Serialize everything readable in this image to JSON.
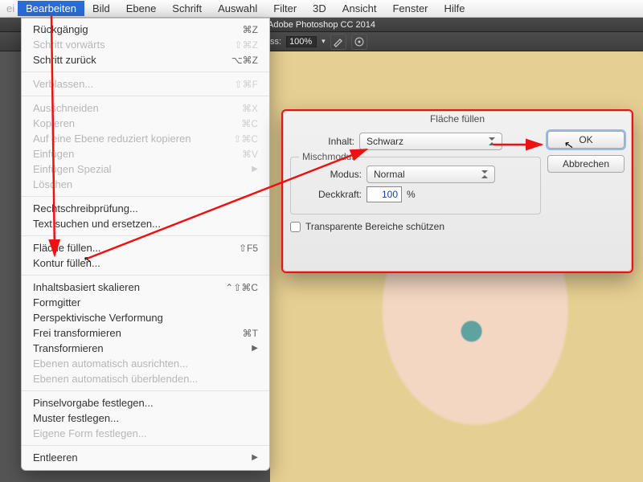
{
  "menubar": {
    "leading_dim": "ei",
    "items": [
      "Bearbeiten",
      "Bild",
      "Ebene",
      "Schrift",
      "Auswahl",
      "Filter",
      "3D",
      "Ansicht",
      "Fenster",
      "Hilfe"
    ],
    "selected_index": 0
  },
  "ps": {
    "title": "Adobe Photoshop CC 2014",
    "toolbar": {
      "label_ss": "ss:",
      "value_ss": "100%"
    }
  },
  "edit_menu": {
    "groups": [
      [
        {
          "label": "Rückgängig",
          "shortcut": "⌘Z",
          "enabled": true
        },
        {
          "label": "Schritt vorwärts",
          "shortcut": "⇧⌘Z",
          "enabled": false
        },
        {
          "label": "Schritt zurück",
          "shortcut": "⌥⌘Z",
          "enabled": true
        }
      ],
      [
        {
          "label": "Verblassen...",
          "shortcut": "⇧⌘F",
          "enabled": false
        }
      ],
      [
        {
          "label": "Ausschneiden",
          "shortcut": "⌘X",
          "enabled": false
        },
        {
          "label": "Kopieren",
          "shortcut": "⌘C",
          "enabled": false
        },
        {
          "label": "Auf eine Ebene reduziert kopieren",
          "shortcut": "⇧⌘C",
          "enabled": false
        },
        {
          "label": "Einfügen",
          "shortcut": "⌘V",
          "enabled": false
        },
        {
          "label": "Einfügen Spezial",
          "shortcut": "",
          "enabled": false,
          "submenu": true
        },
        {
          "label": "Löschen",
          "shortcut": "",
          "enabled": false
        }
      ],
      [
        {
          "label": "Rechtschreibprüfung...",
          "shortcut": "",
          "enabled": true
        },
        {
          "label": "Text suchen und ersetzen...",
          "shortcut": "",
          "enabled": true
        }
      ],
      [
        {
          "label": "Fläche füllen...",
          "shortcut": "⇧F5",
          "enabled": true
        },
        {
          "label": "Kontur füllen...",
          "shortcut": "",
          "enabled": true
        }
      ],
      [
        {
          "label": "Inhaltsbasiert skalieren",
          "shortcut": "⌃⇧⌘C",
          "enabled": true
        },
        {
          "label": "Formgitter",
          "shortcut": "",
          "enabled": true
        },
        {
          "label": "Perspektivische Verformung",
          "shortcut": "",
          "enabled": true
        },
        {
          "label": "Frei transformieren",
          "shortcut": "⌘T",
          "enabled": true
        },
        {
          "label": "Transformieren",
          "shortcut": "",
          "enabled": true,
          "submenu": true
        },
        {
          "label": "Ebenen automatisch ausrichten...",
          "shortcut": "",
          "enabled": false
        },
        {
          "label": "Ebenen automatisch überblenden...",
          "shortcut": "",
          "enabled": false
        }
      ],
      [
        {
          "label": "Pinselvorgabe festlegen...",
          "shortcut": "",
          "enabled": true
        },
        {
          "label": "Muster festlegen...",
          "shortcut": "",
          "enabled": true
        },
        {
          "label": "Eigene Form festlegen...",
          "shortcut": "",
          "enabled": false
        }
      ],
      [
        {
          "label": "Entleeren",
          "shortcut": "",
          "enabled": true,
          "submenu": true
        }
      ]
    ]
  },
  "dialog": {
    "title": "Fläche füllen",
    "content_label": "Inhalt:",
    "content_value": "Schwarz",
    "blend_section": "Mischmodus",
    "mode_label": "Modus:",
    "mode_value": "Normal",
    "opacity_label": "Deckkraft:",
    "opacity_value": "100",
    "opacity_unit": "%",
    "preserve_transparency": "Transparente Bereiche schützen",
    "ok": "OK",
    "cancel": "Abbrechen"
  }
}
